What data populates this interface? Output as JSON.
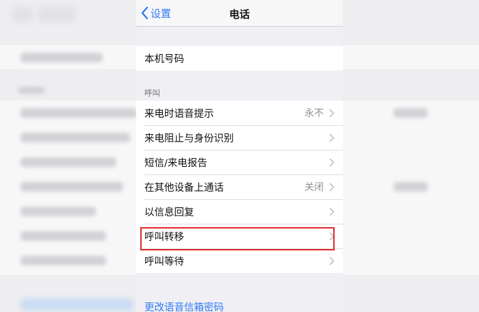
{
  "navbar": {
    "back_label": "设置",
    "title": "电话"
  },
  "my_number": {
    "label": "本机号码"
  },
  "calls_section": {
    "header": "呼叫",
    "items": [
      {
        "label": "来电时语音提示",
        "value": "永不"
      },
      {
        "label": "来电阻止与身份识别",
        "value": ""
      },
      {
        "label": "短信/来电报告",
        "value": ""
      },
      {
        "label": "在其他设备上通话",
        "value": "关闭"
      },
      {
        "label": "以信息回复",
        "value": ""
      },
      {
        "label": "呼叫转移",
        "value": ""
      },
      {
        "label": "呼叫等待",
        "value": ""
      }
    ]
  },
  "voicemail": {
    "change_password_label": "更改语音信箱密码"
  },
  "colors": {
    "accent": "#2f7bf6",
    "highlight": "#e0262b",
    "secondary_text": "#8e8e93"
  }
}
